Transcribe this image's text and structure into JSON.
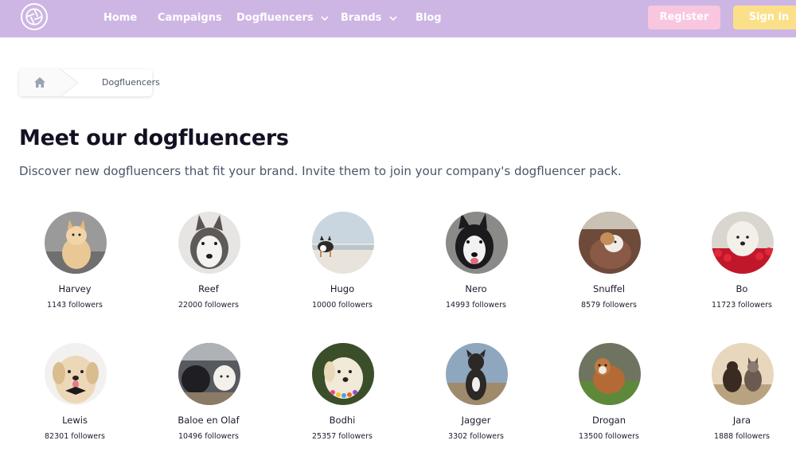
{
  "nav": {
    "items": [
      {
        "label": "Home"
      },
      {
        "label": "Campaigns"
      },
      {
        "label": "Dogfluencers"
      },
      {
        "label": "Brands"
      },
      {
        "label": "Blog"
      }
    ],
    "register_label": "Register",
    "signin_label": "Sign in"
  },
  "breadcrumb": {
    "current": "Dogfluencers"
  },
  "page": {
    "title": "Meet our dogfluencers",
    "subtitle": "Discover new dogfluencers that fit your brand. Invite them to join your company's dogfluencer pack."
  },
  "dogs": [
    {
      "name": "Harvey",
      "followers": "1143 followers"
    },
    {
      "name": "Reef",
      "followers": "22000 followers"
    },
    {
      "name": "Hugo",
      "followers": "10000 followers"
    },
    {
      "name": "Nero",
      "followers": "14993 followers"
    },
    {
      "name": "Snuffel",
      "followers": "8579 followers"
    },
    {
      "name": "Bo",
      "followers": "11723 followers"
    },
    {
      "name": "Lewis",
      "followers": "82301 followers"
    },
    {
      "name": "Baloe en Olaf",
      "followers": "10496 followers"
    },
    {
      "name": "Bodhi",
      "followers": "25357 followers"
    },
    {
      "name": "Jagger",
      "followers": "3302 followers"
    },
    {
      "name": "Drogan",
      "followers": "13500 followers"
    },
    {
      "name": "Jara",
      "followers": "1888 followers"
    }
  ],
  "colors": {
    "nav_bg": "#cdb6e3",
    "register_bg": "#f8c7df",
    "signin_bg": "#fbe08a"
  }
}
